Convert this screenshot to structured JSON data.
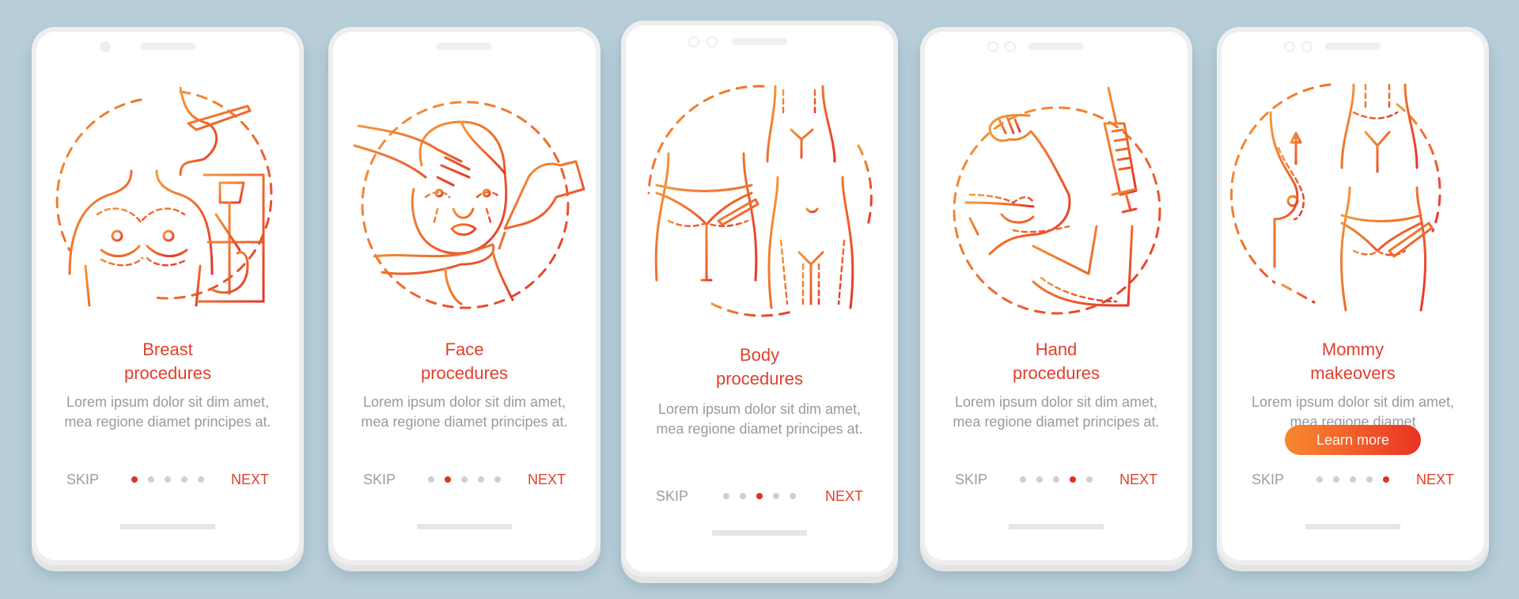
{
  "theme": {
    "background": "#b8cfda",
    "accent": "#e0402c",
    "gradient_start": "#f7892e",
    "gradient_end": "#ea3323",
    "body_text": "#9a9a9a",
    "dot_inactive": "#cfcfcf",
    "dot_active": "#e4301f"
  },
  "screens": [
    {
      "illustration": "breast-procedures-illustration",
      "title_line1": "Breast",
      "title_line2": "procedures",
      "description": "Lorem ipsum dolor sit dim amet, mea regione diamet principes at.",
      "skip_label": "SKIP",
      "next_label": "NEXT",
      "page_index": 1,
      "page_count": 5
    },
    {
      "illustration": "face-procedures-illustration",
      "title_line1": "Face",
      "title_line2": "procedures",
      "description": "Lorem ipsum dolor sit dim amet, mea regione diamet principes at.",
      "skip_label": "SKIP",
      "next_label": "NEXT",
      "page_index": 2,
      "page_count": 5
    },
    {
      "illustration": "body-procedures-illustration",
      "title_line1": "Body",
      "title_line2": "procedures",
      "description": "Lorem ipsum dolor sit dim amet, mea regione diamet principes at.",
      "skip_label": "SKIP",
      "next_label": "NEXT",
      "page_index": 3,
      "page_count": 5
    },
    {
      "illustration": "hand-procedures-illustration",
      "title_line1": "Hand",
      "title_line2": "procedures",
      "description": "Lorem ipsum dolor sit dim amet, mea regione diamet principes at.",
      "skip_label": "SKIP",
      "next_label": "NEXT",
      "page_index": 4,
      "page_count": 5
    },
    {
      "illustration": "mommy-makeovers-illustration",
      "title_line1": "Mommy",
      "title_line2": "makeovers",
      "description": "Lorem ipsum dolor sit dim amet, mea regione diamet",
      "cta_label": "Learn more",
      "skip_label": "SKIP",
      "next_label": "NEXT",
      "page_index": 5,
      "page_count": 5
    }
  ]
}
